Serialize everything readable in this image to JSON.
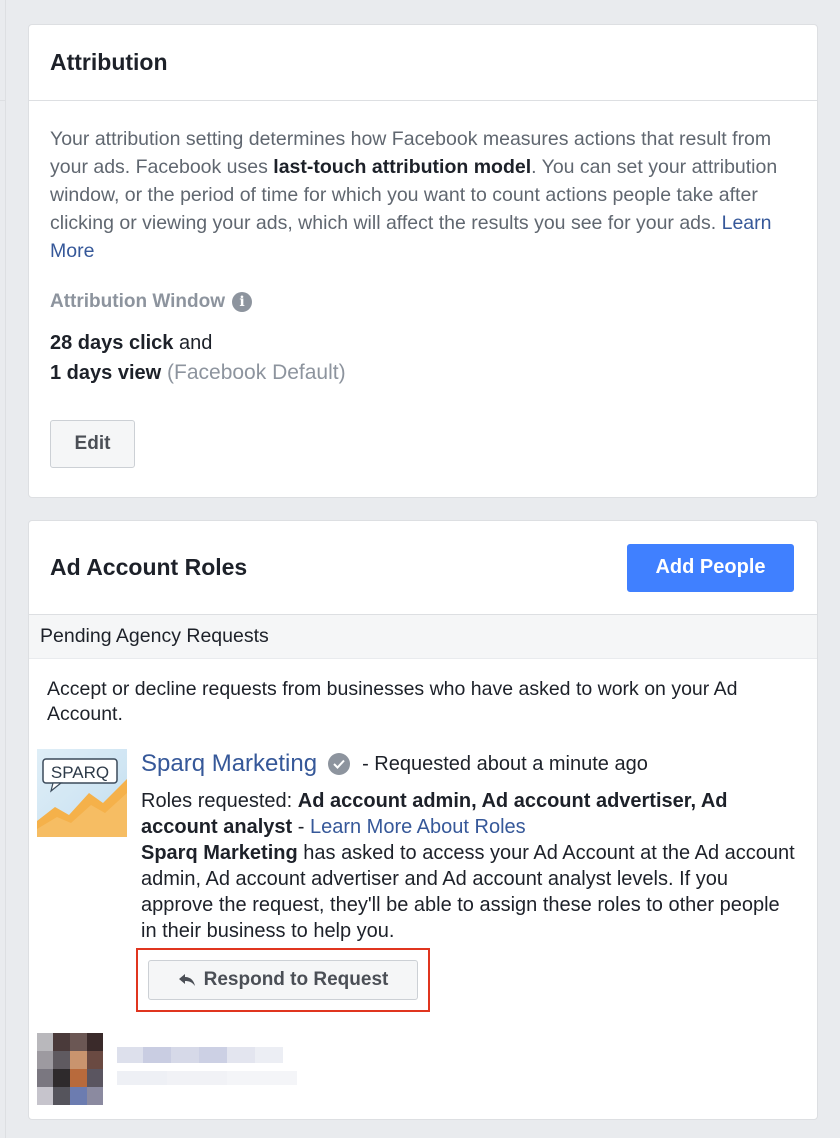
{
  "attribution": {
    "title": "Attribution",
    "desc_part1": "Your attribution setting determines how Facebook measures actions that result from your ads. Facebook uses ",
    "desc_bold": "last-touch attribution model",
    "desc_part2": ". You can set your attribution window, or the period of time for which you want to count actions people take after clicking or viewing your ads, which will affect the results you see for your ads. ",
    "learn_more": "Learn More",
    "window_label": "Attribution Window",
    "click_value": "28 days click",
    "and_text": " and",
    "view_value": "1 days view",
    "default_note": " (Facebook Default)",
    "edit_label": "Edit",
    "info_icon": "i"
  },
  "roles": {
    "title": "Ad Account Roles",
    "add_people_label": "Add People",
    "pending_title": "Pending Agency Requests",
    "pending_desc": "Accept or decline requests from businesses who have asked to work on your Ad Account.",
    "request": {
      "logo_text": "SPARQ",
      "business_name": "Sparq Marketing",
      "requested_time": "- Requested about a minute ago",
      "roles_prefix": "Roles requested: ",
      "roles_list": "Ad account admin, Ad account advertiser, Ad account analyst",
      "roles_dash": " - ",
      "learn_more_roles": "Learn More About Roles",
      "explain_bold": "Sparq Marketing",
      "explain_rest": " has asked to access your Ad Account at the Ad account admin, Ad account advertiser and Ad account analyst levels. If you approve the request, they'll be able to assign these roles to other people in their business to help you.",
      "respond_label": "Respond to Request"
    }
  },
  "colors": {
    "page_bg": "#e9ebee",
    "link": "#365899",
    "primary_button": "#4080ff",
    "highlight_border": "#e0351f"
  }
}
